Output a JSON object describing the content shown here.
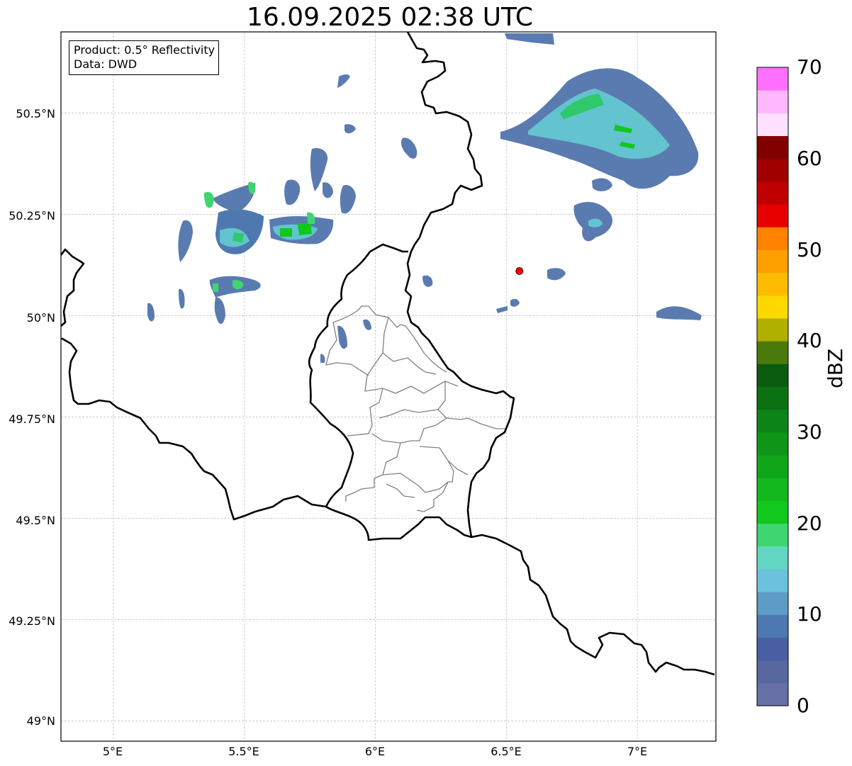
{
  "title": "16.09.2025 02:38 UTC",
  "info_box": {
    "product_line": "Product: 0.5° Reflectivity",
    "data_line": "Data: DWD"
  },
  "map": {
    "type": "weather-radar-reflectivity-map",
    "extent": {
      "lon_min": 4.8,
      "lon_max": 7.3,
      "lat_min": 48.95,
      "lat_max": 50.7
    },
    "lat_ticks": [
      {
        "value": 50.5,
        "label": "50.5°N"
      },
      {
        "value": 50.25,
        "label": "50.25°N"
      },
      {
        "value": 50.0,
        "label": "50°N"
      },
      {
        "value": 49.75,
        "label": "49.75°N"
      },
      {
        "value": 49.5,
        "label": "49.5°N"
      },
      {
        "value": 49.25,
        "label": "49.25°N"
      },
      {
        "value": 49.0,
        "label": "49°N"
      }
    ],
    "lon_ticks": [
      {
        "value": 5.0,
        "label": "5°E"
      },
      {
        "value": 5.5,
        "label": "5.5°E"
      },
      {
        "value": 6.0,
        "label": "6°E"
      },
      {
        "value": 6.5,
        "label": "6.5°E"
      },
      {
        "value": 7.0,
        "label": "7°E"
      }
    ],
    "gridlines": true,
    "radar_marker": {
      "lon": 6.55,
      "lat": 50.11,
      "color": "#ff0000"
    },
    "colors": {
      "border": "#000000",
      "district": "#808080",
      "grid": "#b0b0b0"
    }
  },
  "colorbar": {
    "label": "dBZ",
    "min": 0,
    "max": 70,
    "step": 2.5,
    "ticks": [
      {
        "value": 0,
        "label": "0"
      },
      {
        "value": 10,
        "label": "10"
      },
      {
        "value": 20,
        "label": "20"
      },
      {
        "value": 30,
        "label": "30"
      },
      {
        "value": 40,
        "label": "40"
      },
      {
        "value": 50,
        "label": "50"
      },
      {
        "value": 60,
        "label": "60"
      },
      {
        "value": 70,
        "label": "70"
      }
    ],
    "colors": [
      "#6670a6",
      "#56689f",
      "#4a5fa4",
      "#4e78b0",
      "#5c9cc7",
      "#6cc2dc",
      "#63d6c3",
      "#3fd56f",
      "#12c81c",
      "#12b81c",
      "#10a61a",
      "#0f9518",
      "#0d8416",
      "#0b7113",
      "#0b5c10",
      "#4a7a0c",
      "#b0b000",
      "#ffd800",
      "#ffbb00",
      "#ffa000",
      "#ff8200",
      "#e60000",
      "#c00000",
      "#a00000",
      "#800000",
      "#ffe0ff",
      "#ffb8ff",
      "#ff70ff",
      "#ee38ee"
    ]
  }
}
